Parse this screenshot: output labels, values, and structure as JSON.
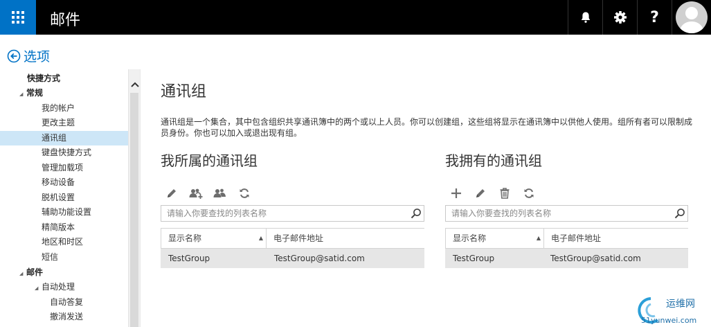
{
  "header": {
    "app_title": "邮件",
    "help_label": "?",
    "icons": [
      "app-launcher-icon",
      "bell-icon",
      "gear-icon",
      "help-icon",
      "user-avatar-icon"
    ],
    "colors": {
      "bar": "#000000",
      "launcher": "#0072c6"
    }
  },
  "options": {
    "label": "选项",
    "icon": "back-arrow-circle-icon"
  },
  "nav": {
    "items": [
      {
        "label": "快捷方式",
        "bold": true,
        "caret": false,
        "indent": 0
      },
      {
        "label": "常规",
        "bold": true,
        "caret": true,
        "indent": 0
      },
      {
        "label": "我的帐户",
        "bold": false,
        "caret": false,
        "indent": 1
      },
      {
        "label": "更改主题",
        "bold": false,
        "caret": false,
        "indent": 1
      },
      {
        "label": "通讯组",
        "bold": false,
        "caret": false,
        "indent": 1,
        "selected": true
      },
      {
        "label": "键盘快捷方式",
        "bold": false,
        "caret": false,
        "indent": 1
      },
      {
        "label": "管理加载项",
        "bold": false,
        "caret": false,
        "indent": 1
      },
      {
        "label": "移动设备",
        "bold": false,
        "caret": false,
        "indent": 1
      },
      {
        "label": "脱机设置",
        "bold": false,
        "caret": false,
        "indent": 1
      },
      {
        "label": "辅助功能设置",
        "bold": false,
        "caret": false,
        "indent": 1
      },
      {
        "label": "精简版本",
        "bold": false,
        "caret": false,
        "indent": 1
      },
      {
        "label": "地区和时区",
        "bold": false,
        "caret": false,
        "indent": 1
      },
      {
        "label": "短信",
        "bold": false,
        "caret": false,
        "indent": 1
      },
      {
        "label": "邮件",
        "bold": true,
        "caret": true,
        "indent": 0
      },
      {
        "label": "自动处理",
        "bold": false,
        "caret": true,
        "indent": 1
      },
      {
        "label": "自动答复",
        "bold": false,
        "caret": false,
        "indent": 2
      },
      {
        "label": "撤消发送",
        "bold": false,
        "caret": false,
        "indent": 2
      }
    ],
    "selected_color": "#cde6f7"
  },
  "main": {
    "title": "通讯组",
    "description": "通讯组是一个集合，其中包含组织共享通讯簿中的两个或以上人员。你可以创建组，这些组将显示在通讯簿中以供他人使用。组所有者可以限制成员身份。你也可以加入或退出现有组。",
    "member_of": {
      "title": "我所属的通讯组",
      "toolbar": [
        "edit-icon",
        "join-group-icon",
        "leave-group-icon",
        "refresh-icon"
      ],
      "search_placeholder": "请输入你要查找的列表名称",
      "columns": [
        "显示名称",
        "电子邮件地址"
      ],
      "rows": [
        {
          "name": "TestGroup",
          "email": "TestGroup@satid.com"
        }
      ]
    },
    "owned": {
      "title": "我拥有的通讯组",
      "toolbar": [
        "add-icon",
        "edit-icon",
        "delete-icon",
        "refresh-icon"
      ],
      "search_placeholder": "请输入你要查找的列表名称",
      "columns": [
        "显示名称",
        "电子邮件地址"
      ],
      "rows": [
        {
          "name": "TestGroup",
          "email": "TestGroup@satid.com"
        }
      ]
    }
  },
  "watermark": {
    "text_top": "运维网",
    "text_bottom": "51yunwei.com"
  }
}
